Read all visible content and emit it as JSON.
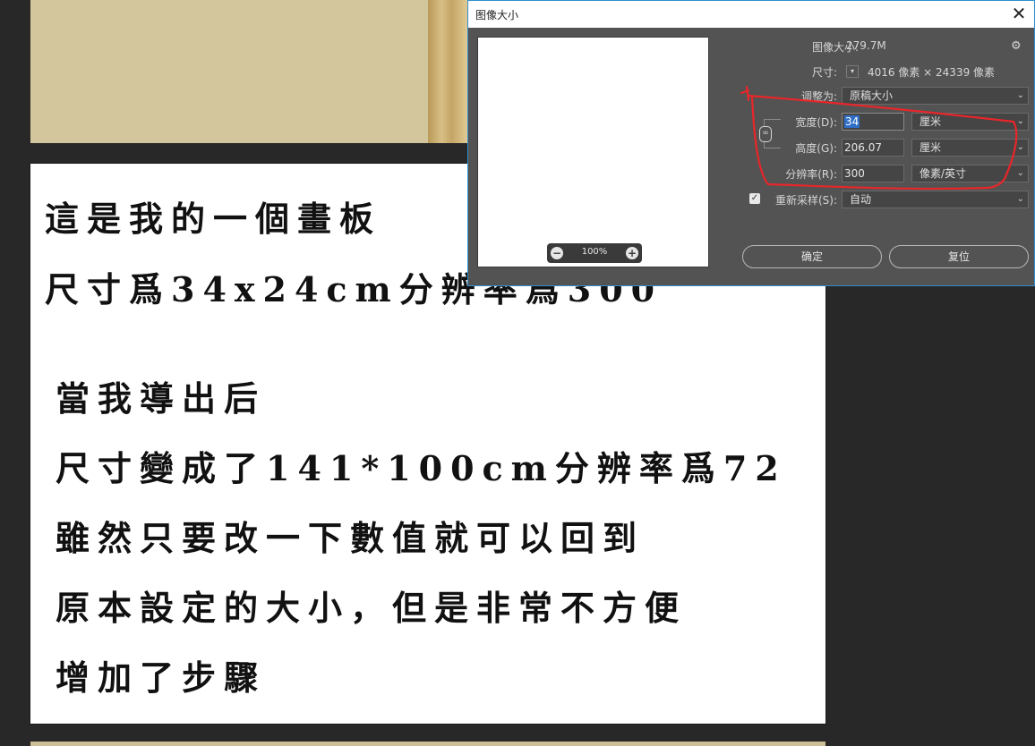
{
  "dialog": {
    "title": "图像大小",
    "image_size_label": "图像大小:",
    "image_size_value": "279.7M",
    "dimensions_label": "尺寸:",
    "dimensions_value": "4016 像素  ×  24339 像素",
    "fit_to_label": "调整为:",
    "fit_to_value": "原稿大小",
    "width_label": "宽度(D):",
    "width_value": "34",
    "width_unit": "厘米",
    "height_label": "高度(G):",
    "height_value": "206.07",
    "height_unit": "厘米",
    "resolution_label": "分辨率(R):",
    "resolution_value": "300",
    "resolution_unit": "像素/英寸",
    "resample_label": "重新采样(S):",
    "resample_value": "自动",
    "zoom": "100%",
    "ok_label": "确定",
    "reset_label": "复位",
    "close_glyph": "✕",
    "icons": [
      "gear-icon",
      "chain-link-icon",
      "zoom-out-icon",
      "zoom-in-icon",
      "close-icon",
      "chevron-down-icon"
    ]
  },
  "document_text": {
    "lines": [
      "這是我的一個畫板",
      "尺寸爲34x24cm分辨率爲300",
      "當我導出后",
      "尺寸變成了141*100cm分辨率爲72",
      "雖然只要改一下數值就可以回到",
      "原本設定的大小，但是非常不方便",
      "增加了步驟"
    ]
  },
  "colors": {
    "workspace": "#282828",
    "dialog_bg": "#535353",
    "accent_border": "#2e8fd0",
    "annotation_red": "#e8262a",
    "tan_panel": "#d3c59c"
  }
}
